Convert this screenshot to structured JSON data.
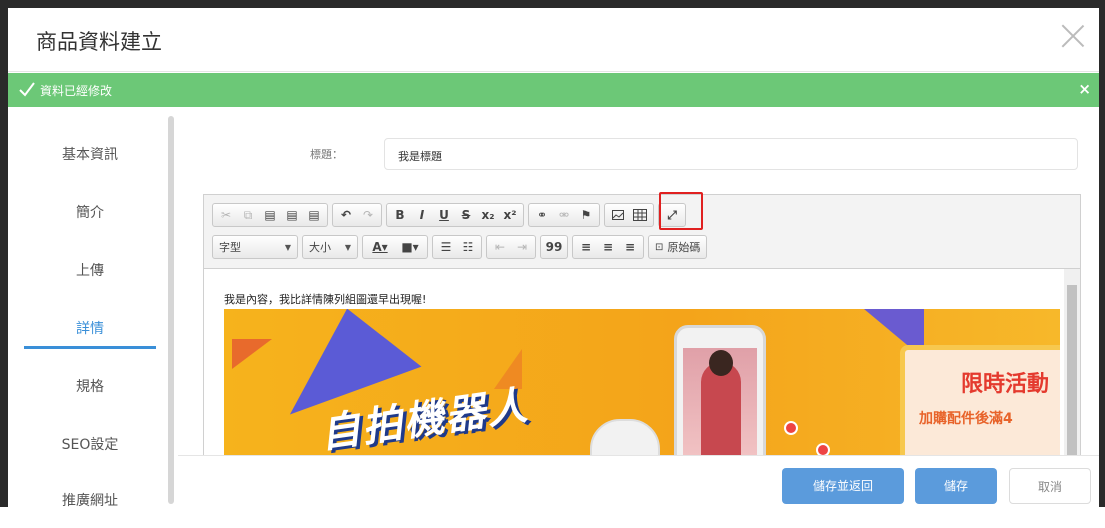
{
  "modal": {
    "title": "商品資料建立"
  },
  "alert": {
    "text": "資料已經修改",
    "close_glyph": "×",
    "color": "#6cc877"
  },
  "sidebar": {
    "items": [
      {
        "label": "基本資訊"
      },
      {
        "label": "簡介"
      },
      {
        "label": "上傳"
      },
      {
        "label": "詳情",
        "active": true
      },
      {
        "label": "規格"
      },
      {
        "label": "SEO設定"
      },
      {
        "label": "推廣網址"
      }
    ]
  },
  "form": {
    "title_label": "標題：",
    "title_value": "我是標題"
  },
  "editor": {
    "toolbar": {
      "font_combo": "字型",
      "size_combo": "大小",
      "source_button": "原始碼",
      "bold": "B",
      "italic": "I",
      "underline": "U",
      "strike": "S",
      "subscript": "x₂",
      "superscript": "x²",
      "blockquote": "99"
    },
    "content_text": "我是內容，我比詳情陳列組圖還早出現喔!",
    "banner": {
      "headline": "自拍機器人",
      "promo_title": "限時活動",
      "promo_sub": "加購配件後滿4"
    }
  },
  "footer": {
    "save_back_label": "儲存並返回",
    "save_label": "儲存",
    "cancel_label": "取消"
  },
  "colors": {
    "primary": "#5b9bdc",
    "active_tab": "#3a8fd8",
    "highlight_box": "#e02020"
  }
}
